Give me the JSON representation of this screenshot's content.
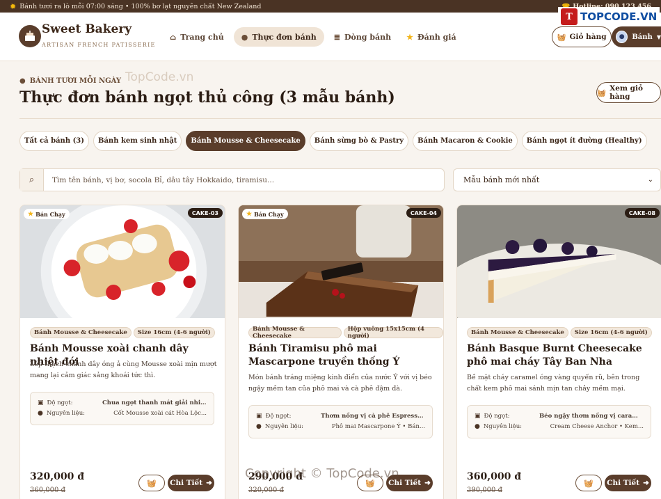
{
  "topbar": {
    "announcement": "Bánh tươi ra lò mỗi 07:00 sáng • 100% bơ lạt nguyên chất New Zealand",
    "hotline": "Hotline: 090 123 456"
  },
  "brand": {
    "name": "Sweet Bakery",
    "tagline": "ARTISAN FRENCH PATISSERIE"
  },
  "nav": [
    {
      "label": "Trang chủ",
      "icon": "home-icon"
    },
    {
      "label": "Thực đơn bánh",
      "icon": "cookie-icon",
      "active": true
    },
    {
      "label": "Dòng bánh",
      "icon": "layers-icon"
    },
    {
      "label": "Đánh giá",
      "icon": "star-icon"
    }
  ],
  "header": {
    "cart_label": "Giỏ hàng",
    "user_label": "Bánh"
  },
  "watermark": {
    "logo": "TOPCODE.VN",
    "site": "TopCode.vn",
    "copyright": "Copyright © TopCode.vn"
  },
  "page": {
    "eyebrow": "BÁNH TƯƠI MỖI NGÀY",
    "title": "Thực đơn bánh ngọt thủ công (3 mẫu bánh)",
    "view_cart": "Xem giỏ hàng"
  },
  "tabs": [
    {
      "label": "Tất cả bánh (3)"
    },
    {
      "label": "Bánh kem sinh nhật"
    },
    {
      "label": "Bánh Mousse & Cheesecake",
      "active": true
    },
    {
      "label": "Bánh sừng bò & Pastry"
    },
    {
      "label": "Bánh Macaron & Cookie"
    },
    {
      "label": "Bánh ngọt ít đường (Healthy)"
    }
  ],
  "search": {
    "placeholder": "Tìm tên bánh, vị bơ, socola Bỉ, dâu tây Hokkaido, tiramisu...",
    "value": ""
  },
  "sort": {
    "selected": "Mẫu bánh mới nhất"
  },
  "labels": {
    "sweetness": "Độ ngọt:",
    "ingredients": "Nguyên liệu:",
    "detail": "Chi Tiết",
    "hot": "Bán Chạy"
  },
  "products": [
    {
      "code": "CAKE-03",
      "hot": true,
      "category": "Bánh Mousse & Cheesecake",
      "size": "Size 16cm (4-6 người)",
      "name": "Bánh Mousse xoài chanh dây nhiệt đới",
      "description": "Lớp thạch chanh dây óng ả cùng Mousse xoài mịn mượt mang lại cảm giác sảng khoái tức thì.",
      "sweetness": "Chua ngọt thanh mát giải nhiệt",
      "ingredients": "Cốt Mousse xoài cát Hòa Lộc...",
      "price": "320,000 đ",
      "old_price": "360,000 đ"
    },
    {
      "code": "CAKE-04",
      "hot": true,
      "category": "Bánh Mousse & Cheesecake",
      "size": "Hộp vuông 15x15cm (4 người)",
      "name": "Bánh Tiramisu phô mai Mascarpone truyền thống Ý",
      "description": "Món bánh tráng miệng kinh điển của nước Ý với vị béo ngậy mềm tan của phô mai và cà phê đậm đà.",
      "sweetness": "Thơm nồng vị cà phê Espresso & Rượu Rh...",
      "ingredients": "Phô mai Mascarpone Ý • Bán...",
      "price": "290,000 đ",
      "old_price": "320,000 đ"
    },
    {
      "code": "CAKE-08",
      "hot": false,
      "category": "Bánh Mousse & Cheesecake",
      "size": "Size 16cm (4-6 người)",
      "name": "Bánh Basque Burnt Cheesecake phô mai cháy Tây Ban Nha",
      "description": "Bề mặt cháy caramel óng vàng quyến rũ, bên trong chất kem phô mai sánh mịn tan chảy mềm mại.",
      "sweetness": "Béo ngậy thơm nồng vị caramel cháy",
      "ingredients": "Cream Cheese Anchor • Kem...",
      "price": "360,000 đ",
      "old_price": "390,000 đ"
    }
  ],
  "colors": {
    "primary": "#5a3d2b",
    "topbar": "#4a3324",
    "background": "#f8f4ef",
    "star": "#f2b51c"
  }
}
